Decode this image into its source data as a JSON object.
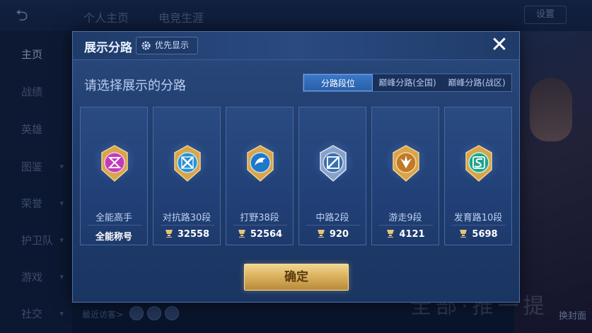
{
  "background": {
    "top_tabs": [
      "个人主页",
      "电竞生涯"
    ],
    "settings_label": "设置",
    "sidebar": [
      {
        "label": "主页",
        "active": true,
        "chevron": false
      },
      {
        "label": "战绩",
        "active": false,
        "chevron": false
      },
      {
        "label": "英雄",
        "active": false,
        "chevron": false
      },
      {
        "label": "图鉴",
        "active": false,
        "chevron": true
      },
      {
        "label": "荣誉",
        "active": false,
        "chevron": true
      },
      {
        "label": "护卫队",
        "active": false,
        "chevron": true
      },
      {
        "label": "游戏",
        "active": false,
        "chevron": true
      },
      {
        "label": "社交",
        "active": false,
        "chevron": true
      }
    ],
    "recent_visitors": "最近访客>",
    "big_text": "全部·推一提",
    "switch_label": "换封面"
  },
  "modal": {
    "title": "展示分路",
    "pref_button": "优先显示",
    "subtitle": "请选择展示的分路",
    "tabs": [
      {
        "label": "分路段位",
        "active": true
      },
      {
        "label": "巅峰分路(全国)",
        "active": false
      },
      {
        "label": "巅峰分路(战区)",
        "active": false
      }
    ],
    "cards": [
      {
        "role": "全能高手",
        "value": "全能称号",
        "has_trophy": false,
        "badge_color": "#c23ab8",
        "badge_icon": "diamond-pattern"
      },
      {
        "role": "对抗路30段",
        "value": "32558",
        "has_trophy": true,
        "badge_color": "#2a8fd0",
        "badge_icon": "crossed-swords"
      },
      {
        "role": "打野38段",
        "value": "52564",
        "has_trophy": true,
        "badge_color": "#1e78c8",
        "badge_icon": "dragon"
      },
      {
        "role": "中路2段",
        "value": "920",
        "has_trophy": true,
        "badge_color": "#3a6fae",
        "badge_icon": "slash"
      },
      {
        "role": "游走9段",
        "value": "4121",
        "has_trophy": true,
        "badge_color": "#c07a28",
        "badge_icon": "wings"
      },
      {
        "role": "发育路10段",
        "value": "5698",
        "has_trophy": true,
        "badge_color": "#1ea38a",
        "badge_icon": "s-rune"
      }
    ],
    "confirm_label": "确定"
  }
}
